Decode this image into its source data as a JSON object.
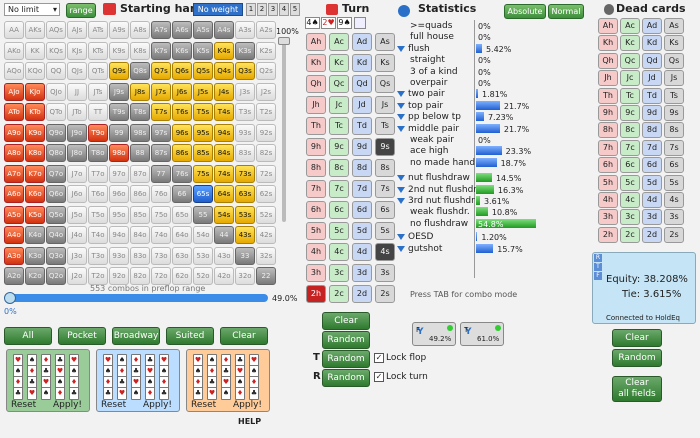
{
  "top": {
    "limit_select": "No limit",
    "range_btn": "range",
    "starting_hand": "Starting hand",
    "no_weight": "No weight",
    "num_btns": [
      "1",
      "2",
      "3",
      "4",
      "5"
    ],
    "slider_top": "100%"
  },
  "range_grid": {
    "rows": [
      [
        "AA",
        "AKs",
        "AQs",
        "AJs",
        "ATs",
        "A9s",
        "A8s",
        "A7s",
        "A6s",
        "A5s",
        "A4s",
        "A3s",
        "A2s"
      ],
      [
        "AKo",
        "KK",
        "KQs",
        "KJs",
        "KTs",
        "K9s",
        "K8s",
        "K7s",
        "K6s",
        "K5s",
        "K4s",
        "K3s",
        "K2s"
      ],
      [
        "AQo",
        "KQo",
        "QQ",
        "QJs",
        "QTs",
        "Q9s",
        "Q8s",
        "Q7s",
        "Q6s",
        "Q5s",
        "Q4s",
        "Q3s",
        "Q2s"
      ],
      [
        "AJo",
        "KJo",
        "QJo",
        "JJ",
        "JTs",
        "J9s",
        "J8s",
        "J7s",
        "J6s",
        "J5s",
        "J4s",
        "J3s",
        "J2s"
      ],
      [
        "ATo",
        "KTo",
        "QTo",
        "JTo",
        "TT",
        "T9s",
        "T8s",
        "T7s",
        "T6s",
        "T5s",
        "T4s",
        "T3s",
        "T2s"
      ],
      [
        "A9o",
        "K9o",
        "Q9o",
        "J9o",
        "T9o",
        "99",
        "98s",
        "97s",
        "96s",
        "95s",
        "94s",
        "93s",
        "92s"
      ],
      [
        "A8o",
        "K8o",
        "Q8o",
        "J8o",
        "T8o",
        "98o",
        "88",
        "87s",
        "86s",
        "85s",
        "84s",
        "83s",
        "82s"
      ],
      [
        "A7o",
        "K7o",
        "Q7o",
        "J7o",
        "T7o",
        "97o",
        "87o",
        "77",
        "76s",
        "75s",
        "74s",
        "73s",
        "72s"
      ],
      [
        "A6o",
        "K6o",
        "Q6o",
        "J6o",
        "T6o",
        "96o",
        "86o",
        "76o",
        "66",
        "65s",
        "64s",
        "63s",
        "62s"
      ],
      [
        "A5o",
        "K5o",
        "Q5o",
        "J5o",
        "T5o",
        "95o",
        "85o",
        "75o",
        "65o",
        "55",
        "54s",
        "53s",
        "52s"
      ],
      [
        "A4o",
        "K4o",
        "Q4o",
        "J4o",
        "T4o",
        "94o",
        "84o",
        "74o",
        "64o",
        "54o",
        "44",
        "43s",
        "42s"
      ],
      [
        "A3o",
        "K3o",
        "Q3o",
        "J3o",
        "T3o",
        "93o",
        "83o",
        "73o",
        "63o",
        "53o",
        "43o",
        "33",
        "32s"
      ],
      [
        "A2o",
        "K2o",
        "Q2o",
        "J2o",
        "T2o",
        "92o",
        "82o",
        "72o",
        "62o",
        "52o",
        "42o",
        "32o",
        "22"
      ]
    ],
    "combo_text": "553 combos in preflop range",
    "slider_value": "49.0%",
    "slider_left": "0%"
  },
  "range_buttons": [
    "All",
    "Pocket",
    "Broadway",
    "Suited",
    "Clear"
  ],
  "presets": [
    {
      "reset": "Reset",
      "apply": "Apply!"
    },
    {
      "reset": "Reset",
      "apply": "Apply!"
    },
    {
      "reset": "Reset",
      "apply": "Apply!"
    }
  ],
  "help": "HELP",
  "turn": {
    "title": "Turn",
    "board": [
      "4♠",
      "2♥",
      "9♠"
    ],
    "ranks": [
      "A",
      "K",
      "Q",
      "J",
      "T",
      "9",
      "8",
      "7",
      "6",
      "5",
      "4",
      "3",
      "2"
    ],
    "clear": "Clear",
    "random": "Random",
    "random2": "Random",
    "random3": "Random",
    "lock_flop": "Lock flop",
    "lock_turn": "Lock turn",
    "t_label": "T",
    "r_label": "R"
  },
  "stats": {
    "title": "Statistics",
    "absolute": "Absolute",
    "normal": "Normal",
    "rows": [
      {
        "label": ">=quads",
        "pct": "0%",
        "v": 0
      },
      {
        "label": "full house",
        "pct": "0%",
        "v": 0
      },
      {
        "label": "flush",
        "pct": "5.42%",
        "v": 5.42,
        "f": true
      },
      {
        "label": "straight",
        "pct": "0%",
        "v": 0
      },
      {
        "label": "3 of a kind",
        "pct": "0%",
        "v": 0
      },
      {
        "label": "overpair",
        "pct": "0%",
        "v": 0
      },
      {
        "label": "two pair",
        "pct": "1.81%",
        "v": 1.81,
        "f": true
      },
      {
        "label": "top pair",
        "pct": "21.7%",
        "v": 21.7,
        "f": true
      },
      {
        "label": "pp below tp",
        "pct": "7.23%",
        "v": 7.23,
        "f": true
      },
      {
        "label": "middle pair",
        "pct": "21.7%",
        "v": 21.7,
        "f": true
      },
      {
        "label": "weak pair",
        "pct": "0%",
        "v": 0
      },
      {
        "label": "ace high",
        "pct": "23.3%",
        "v": 23.3
      },
      {
        "label": "no made hand",
        "pct": "18.7%",
        "v": 18.7
      }
    ],
    "draws": [
      {
        "label": "nut flushdraw",
        "pct": "14.5%",
        "v": 14.5,
        "f": true
      },
      {
        "label": "2nd nut flushdr",
        "pct": "16.3%",
        "v": 16.3,
        "f": true
      },
      {
        "label": "3rd nut flushdr",
        "pct": "3.61%",
        "v": 3.61,
        "f": true
      },
      {
        "label": "weak flushdr.",
        "pct": "10.8%",
        "v": 10.8
      },
      {
        "label": "no flushdraw",
        "pct": "54.8%",
        "v": 54.8
      }
    ],
    "misc": [
      {
        "label": "OESD",
        "pct": "1.20%",
        "v": 1.2,
        "f": true
      },
      {
        "label": "gutshot",
        "pct": "15.7%",
        "v": 15.7,
        "f": true
      }
    ],
    "tab_text": "Press TAB for combo mode",
    "filter1": "49.2%",
    "filter2": "61.0%",
    "f_letter": "F",
    "t_letter": "T"
  },
  "dead": {
    "title": "Dead cards",
    "equity": "Equity: 38.208%",
    "tie": "Tie: 3.615%",
    "connected": "Connected to HoldEq",
    "clear": "Clear",
    "random": "Random",
    "clear_all": "Clear\nall fields",
    "rlabels": [
      "R",
      "T",
      "F"
    ]
  },
  "colors": {
    "accent": "#2f7a2f",
    "selected": "#c62222"
  }
}
